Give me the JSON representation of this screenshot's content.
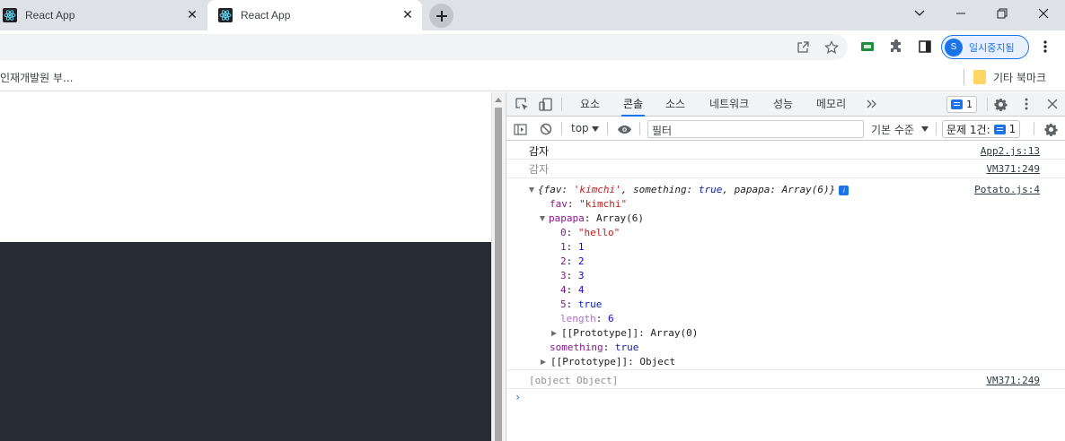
{
  "tabs": [
    {
      "title": "React App",
      "favicon": "react-icon",
      "active": false
    },
    {
      "title": "React App",
      "favicon": "react-icon",
      "active": true
    }
  ],
  "window_controls": [
    "chevron-down-icon",
    "minimize-icon",
    "restore-icon",
    "close-icon"
  ],
  "toolbar": {
    "profile_initial": "S",
    "profile_label": "일시중지됨"
  },
  "bookmarks": {
    "left_label": "인재개발원 부...",
    "right_label": "기타 북마크"
  },
  "devtools": {
    "tabs": [
      "요소",
      "콘솔",
      "소스",
      "네트워크",
      "성능",
      "메모리"
    ],
    "active_tab": "콘솔",
    "issues_count": "1",
    "context": "top",
    "filter_placeholder": "필터",
    "level_label": "기본 수준",
    "issues_label": "문제 1건:",
    "issues_label_count": "1"
  },
  "console": {
    "log1": {
      "text": "감자",
      "source": "App2.js:13"
    },
    "log2": {
      "text": "감자",
      "source": "VM371:249"
    },
    "log3": {
      "source": "Potato.js:4",
      "preview_open": "{",
      "preview_fav_key": "fav",
      "preview_fav_val": "'kimchi'",
      "preview_something_key": "something",
      "preview_something_val": "true",
      "preview_papapa_key": "papapa",
      "preview_papapa_val": "Array(6)",
      "preview_close": "}",
      "fav_key": "fav",
      "fav_val": "\"kimchi\"",
      "papapa_key": "papapa",
      "papapa_val": "Array(6)",
      "items": [
        {
          "index": "0",
          "value": "\"hello\"",
          "kind": "str"
        },
        {
          "index": "1",
          "value": "1",
          "kind": "num"
        },
        {
          "index": "2",
          "value": "2",
          "kind": "num"
        },
        {
          "index": "3",
          "value": "3",
          "kind": "num"
        },
        {
          "index": "4",
          "value": "4",
          "kind": "num"
        },
        {
          "index": "5",
          "value": "true",
          "kind": "kw"
        }
      ],
      "length_key": "length",
      "length_val": "6",
      "proto_array": "[[Prototype]]",
      "proto_array_val": "Array(0)",
      "something_key": "something",
      "something_val": "true",
      "proto_obj": "[[Prototype]]",
      "proto_obj_val": "Object"
    },
    "log4": {
      "text": "[object Object]",
      "source": "VM371:249"
    },
    "prompt": "›"
  },
  "colors": {
    "accent": "#1a73e8",
    "page_dark": "#282c34",
    "string": "#c41a16",
    "number": "#1c00cf",
    "property": "#881391"
  }
}
